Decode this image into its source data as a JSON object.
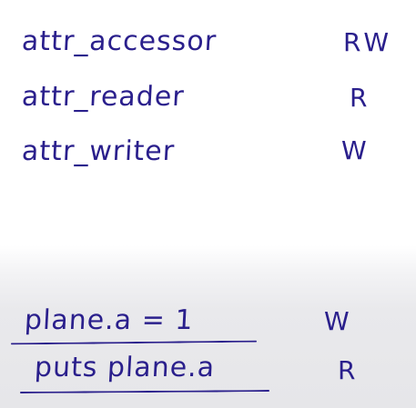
{
  "accessors": [
    {
      "name": "attr_accessor",
      "mode": "RW"
    },
    {
      "name": "attr_reader",
      "mode": "R"
    },
    {
      "name": "attr_writer",
      "mode": "W"
    }
  ],
  "examples": [
    {
      "code": "plane.a = 1",
      "mode": "W"
    },
    {
      "code": "puts plane.a",
      "mode": "R"
    }
  ],
  "ink_color": "#2a1f8c"
}
